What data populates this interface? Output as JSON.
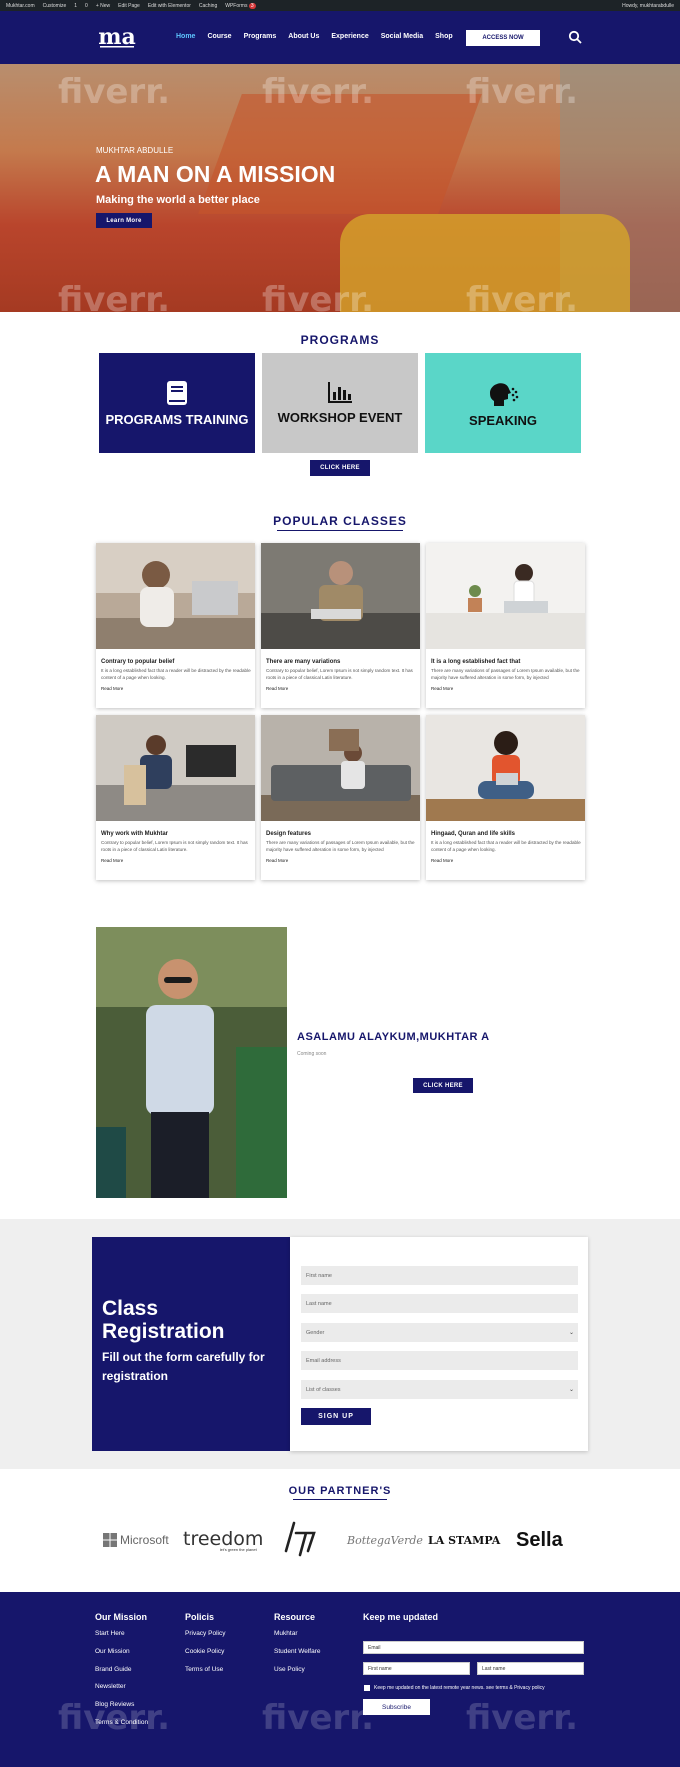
{
  "admin_bar": {
    "items": [
      "Mukhtar.com",
      "Customize",
      "1",
      "0",
      "+ New",
      "Edit Page",
      "Edit with Elementor",
      "Caching",
      "WPForms"
    ],
    "wpforms_count": "3",
    "greeting": "Howdy, mukhtarabdulle"
  },
  "nav": {
    "logo_text": "ma",
    "links": [
      "Home",
      "Course",
      "Programs",
      "About Us",
      "Experience",
      "Social Media",
      "Shop"
    ],
    "access_button": "ACCESS NOW"
  },
  "hero": {
    "eyebrow": "MUKHTAR ABDULLE",
    "title": "A MAN ON A MISSION",
    "subtitle": "Making the world a better place",
    "button": "Learn More",
    "watermark": "fiverr."
  },
  "programs": {
    "title": "PROGRAMS",
    "cards": [
      {
        "label": "PROGRAMS TRAINING",
        "icon": "book-icon",
        "bg": "#16166b",
        "fg": "#ffffff"
      },
      {
        "label": "WORKSHOP EVENT",
        "icon": "bar-chart-icon",
        "bg": "#c8c8c8",
        "fg": "#111111"
      },
      {
        "label": "SPEAKING",
        "icon": "speaking-head-icon",
        "bg": "#5ad6c8",
        "fg": "#111111"
      }
    ],
    "button": "CLICK HERE"
  },
  "classes": {
    "title": "POPULAR CLASSES",
    "read_more": "Read More",
    "items": [
      {
        "title": "Contrary to popular belief",
        "desc": "It is a long established fact that a reader will be distracted by the readable content of a page when looking."
      },
      {
        "title": "There are many variations",
        "desc": "Contrary to popular belief, Lorem Ipsum is not simply random text. It has roots in a piece of classical Latin literature."
      },
      {
        "title": "It is a long established fact that",
        "desc": "There are many variations of passages of Lorem Ipsum available, but the majority have suffered alteration in some form, by injected"
      },
      {
        "title": "Why work with Mukhtar",
        "desc": "Contrary to popular belief, Lorem Ipsum is not simply random text. It has roots in a piece of classical Latin literature."
      },
      {
        "title": "Design features",
        "desc": "There are many variations of passages of Lorem Ipsum available, but the majority have suffered alteration in some form, by injected"
      },
      {
        "title": "Hingaad, Quran and life skills",
        "desc": "It is a long established fact that a reader will be distracted by the readable content of a page when looking."
      }
    ]
  },
  "about": {
    "greeting": "ASALAMU ALAYKUM,MUKHTAR A",
    "text": "Coming soon",
    "button": "CLICK HERE"
  },
  "registration": {
    "title": "Class Registration",
    "subtitle": "Fill out the form carefully for registration",
    "fields": [
      "First name",
      "Last name",
      "Gender",
      "Email address",
      "List of classes"
    ],
    "button": "SIGN UP"
  },
  "partners": {
    "title": "OUR PARTNER'S",
    "logos": [
      "Microsoft",
      "treedom",
      "hp",
      "BottegaVerde",
      "LA STAMPA",
      "Sella"
    ],
    "treedom_tagline": "let's green the planet"
  },
  "footer": {
    "columns": [
      {
        "title": "Our Mission",
        "links": [
          "Start Here",
          "Our Mission",
          "Brand Guide",
          "Newsletter",
          "Blog Reviews",
          "Terms & Condition"
        ]
      },
      {
        "title": "Policis",
        "links": [
          "Privacy Policy",
          "Cookie Policy",
          "Terms of Use"
        ]
      },
      {
        "title": "Resource",
        "links": [
          "Mukhtar",
          "Student Welfare",
          "Use Policy"
        ]
      }
    ],
    "newsletter": {
      "title": "Keep me updated",
      "email_placeholder": "Email",
      "first_placeholder": "First name",
      "last_placeholder": "Last name",
      "consent": "Keep me updated on the latest remote year news. see terms & Privacy policy",
      "button": "Subscribe"
    }
  },
  "colors": {
    "navy": "#16166b",
    "teal": "#5ad6c8",
    "grey_card": "#c8c8c8",
    "active_link": "#5ec5ff"
  }
}
